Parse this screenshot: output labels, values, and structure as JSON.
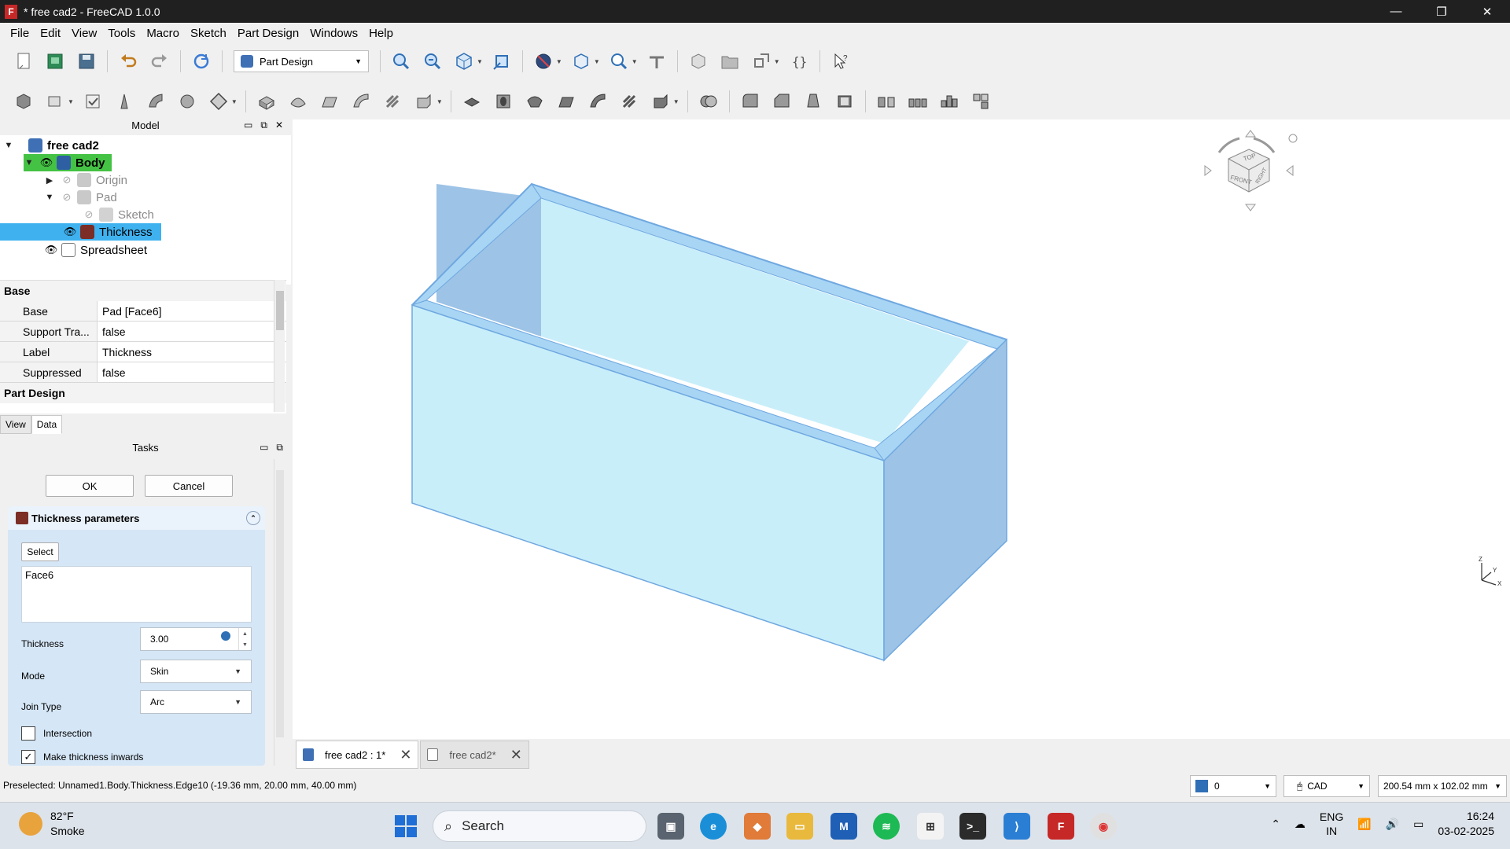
{
  "window": {
    "title": "* free cad2 - FreeCAD 1.0.0",
    "app_icon": "F",
    "min_glyph": "—",
    "max_glyph": "❐",
    "close_glyph": "✕"
  },
  "menu": [
    "File",
    "Edit",
    "View",
    "Tools",
    "Macro",
    "Sketch",
    "Part Design",
    "Windows",
    "Help"
  ],
  "toolbar": {
    "workbench": "Part Design"
  },
  "tree": {
    "panel_title": "Model",
    "document": "free cad2",
    "body": "Body",
    "origin": "Origin",
    "pad": "Pad",
    "sketch": "Sketch",
    "thickness": "Thickness",
    "spreadsheet": "Spreadsheet"
  },
  "properties": {
    "group_base": "Base",
    "rows": [
      {
        "name": "Base",
        "value": "Pad [Face6]"
      },
      {
        "name": "Support Tra...",
        "value": "false"
      },
      {
        "name": "Label",
        "value": "Thickness"
      },
      {
        "name": "Suppressed",
        "value": "false"
      }
    ],
    "group_part_design": "Part Design",
    "tab_view": "View",
    "tab_data": "Data"
  },
  "tasks": {
    "panel_title": "Tasks",
    "ok": "OK",
    "cancel": "Cancel",
    "params_title": "Thickness parameters",
    "select": "Select",
    "faces": "Face6",
    "thickness_label": "Thickness",
    "thickness_value": "3.00",
    "mode_label": "Mode",
    "mode_value": "Skin",
    "join_label": "Join Type",
    "join_value": "Arc",
    "intersection_label": "Intersection",
    "intersection_checked": false,
    "inwards_label": "Make thickness inwards",
    "inwards_checked": true
  },
  "navcube": {
    "top": "TOP",
    "front": "FRONT",
    "right": "RIGHT"
  },
  "axis": {
    "x": "X",
    "y": "Y",
    "z": "Z"
  },
  "doc_tabs": [
    {
      "label": "free cad2 : 1*"
    },
    {
      "label": "free cad2*"
    }
  ],
  "status": {
    "preselected": "Preselected: Unnamed1.Body.Thickness.Edge10 (-19.36 mm, 20.00 mm, 40.00 mm)",
    "layer_value": "0",
    "nav_style": "CAD",
    "dimensions": "200.54 mm x 102.02 mm"
  },
  "taskbar": {
    "temperature": "82°F",
    "condition": "Smoke",
    "search": "Search",
    "lang_top": "ENG",
    "lang_bottom": "IN",
    "time": "16:24",
    "date": "03-02-2025"
  },
  "colors": {
    "box_face": "#c8eefa",
    "box_side": "#9dc3e6",
    "box_edge": "#6fa8e0",
    "selection": "#3fb1ef",
    "body_highlight": "#44c244"
  }
}
